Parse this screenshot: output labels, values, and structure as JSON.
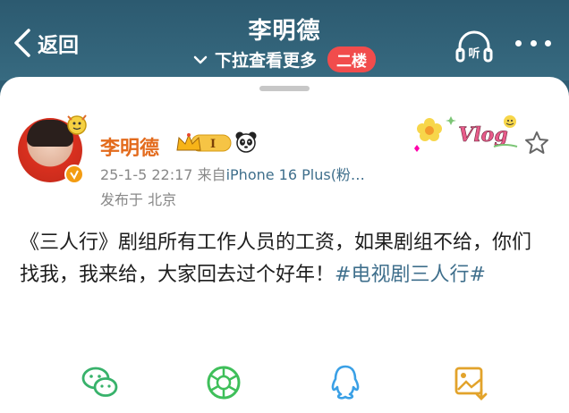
{
  "header": {
    "back_label": "返回",
    "title": "李明德",
    "subline": "下拉查看更多",
    "floor_badge": "二楼",
    "listen_label": "听"
  },
  "post": {
    "username": "李明德",
    "level_badge": "I",
    "time": "25-1-5 22:17",
    "source_prefix": "来自",
    "source": "iPhone 16 Plus(粉…",
    "location": "发布于 北京",
    "text_part1": "《三人行》剧组所有工作人员的工资，如果剧组不给，你们找我，我来给，大家回去过个好年！",
    "hashtag": "#电视剧三人行#",
    "sticker_text": "Vlog"
  },
  "colors": {
    "header_bg": "#2f5d73",
    "accent_link": "#3f6f8c",
    "username": "#e36b1d",
    "badge_red": "#f14c4c"
  },
  "share_icons": [
    "wechat-icon",
    "moments-icon",
    "qq-icon",
    "save-image-icon"
  ]
}
